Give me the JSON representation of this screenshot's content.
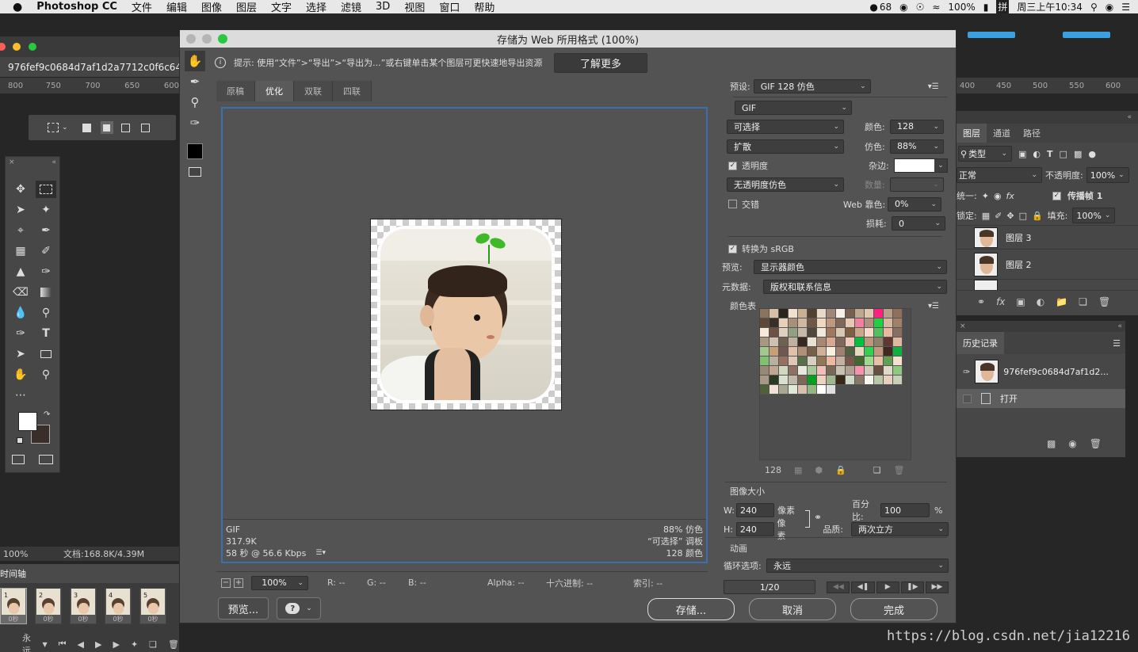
{
  "menubar": {
    "apple": "",
    "app": "Photoshop CC",
    "items": [
      "文件",
      "编辑",
      "图像",
      "图层",
      "文字",
      "选择",
      "滤镜",
      "3D",
      "视图",
      "窗口",
      "帮助"
    ],
    "qq_count": "68",
    "battery": "100%",
    "ime": "拼",
    "clock": "周三上午10:34"
  },
  "ps": {
    "doc_tab": "976fef9c0684d7af1d2a7712c0f6c64",
    "ruler": [
      "800",
      "750",
      "700",
      "650",
      "600"
    ],
    "status_zoom": "100%",
    "status_doc": "文档:168.8K/4.39M",
    "timeline_label": "时间轴",
    "frame_numbers": [
      "1",
      "2",
      "3",
      "4",
      "5"
    ],
    "frame_delay": "0秒",
    "loop": "永远"
  },
  "right_panels": {
    "ruler": [
      "400",
      "450",
      "500",
      "550",
      "600"
    ],
    "tabs": [
      "图层",
      "通道",
      "路径"
    ],
    "kind": "类型",
    "blend": "正常",
    "opacity_label": "不透明度:",
    "opacity": "100%",
    "unify": "统一:",
    "propagate": "传播帧 1",
    "lock": "锁定:",
    "fill_label": "填充:",
    "fill": "100%",
    "layers": [
      "图层 3",
      "图层 2"
    ],
    "history_title": "历史记录",
    "history_snapshot": "976fef9c0684d7af1d2...",
    "history_open": "打开"
  },
  "dialog": {
    "title": "存储为 Web 所用格式 (100%)",
    "hint": "提示: 使用“文件”>“导出”>“导出为...”或右键单击某个图层可更快速地导出资源",
    "learn_more": "了解更多",
    "tabs": [
      "原稿",
      "优化",
      "双联",
      "四联"
    ],
    "info_left": [
      "GIF",
      "317.9K",
      "58 秒 @ 56.6 Kbps"
    ],
    "info_right": [
      "88% 仿色",
      "“可选择” 调板",
      "128 颜色"
    ],
    "zoom": "100%",
    "r": "R: --",
    "g": "G: --",
    "b": "B: --",
    "alpha": "Alpha: --",
    "hex": "十六进制: --",
    "index": "索引: --",
    "preview_btn": "预览...",
    "save_btn": "存储...",
    "cancel_btn": "取消",
    "done_btn": "完成"
  },
  "settings": {
    "preset_label": "预设:",
    "preset": "GIF 128 仿色",
    "format": "GIF",
    "reduction": "可选择",
    "colors_label": "颜色:",
    "colors": "128",
    "dither_algo": "扩散",
    "dither_label": "仿色:",
    "dither": "88%",
    "transparency": "透明度",
    "matte_label": "杂边:",
    "transparency_dither": "无透明度仿色",
    "amount_label": "数量:",
    "interlaced": "交错",
    "websnap_label": "Web 靠色:",
    "websnap": "0%",
    "lossy_label": "损耗:",
    "lossy": "0",
    "srgb": "转换为 sRGB",
    "preview_label": "预览:",
    "preview_value": "显示器颜色",
    "metadata_label": "元数据:",
    "metadata": "版权和联系信息",
    "color_table": "颜色表",
    "color_count": "128",
    "image_size": "图像大小",
    "w_label": "W:",
    "w": "240",
    "h_label": "H:",
    "h": "240",
    "unit": "像素",
    "percent_label": "百分比:",
    "percent": "100",
    "pct_sign": "%",
    "quality_label": "品质:",
    "quality": "两次立方",
    "animation": "动画",
    "loop_label": "循环选项:",
    "loop": "永远",
    "frame_counter": "1/20"
  },
  "watermark": "https://blog.csdn.net/jia12216",
  "colors": {
    "accent_border": "#3d6fb0",
    "panel": "#535353",
    "dark": "#262626"
  },
  "palette": [
    "#8b7360",
    "#d8c0a8",
    "#2a231e",
    "#f0e0d0",
    "#c8b090",
    "#504030",
    "#e8d8c8",
    "#a08878",
    "#f8f0e8",
    "#786050",
    "#c0a890",
    "#e0c8b0",
    "#ff2080",
    "#b8a088",
    "#90705a",
    "#604838",
    "#3a2e28",
    "#e8d0b8",
    "#a89078",
    "#d0b8a0",
    "#705848",
    "#f0d8c0",
    "#c09880",
    "#806858",
    "#e8c8b0",
    "#f080a0",
    "#b09080",
    "#20d040",
    "#d8b8a0",
    "#a08068",
    "#f8e8d8",
    "#705040",
    "#e0d0c0",
    "#90a080",
    "#c8b8a8",
    "#504838",
    "#f0e8d8",
    "#a07860",
    "#d8c8b0",
    "#806040",
    "#c8a888",
    "#f8d8c8",
    "#50c060",
    "#e8b8a0",
    "#887060",
    "#a89880",
    "#d0c0b0",
    "#706050",
    "#c0b0a0",
    "#382820",
    "#e8e0d0",
    "#a88870",
    "#d8a890",
    "#806858",
    "#f0c8b8",
    "#00c040",
    "#b89878",
    "#90806a",
    "#603830",
    "#e0b8a0",
    "#a0c890",
    "#c8a078",
    "#705850",
    "#e0c0a8",
    "#b09078",
    "#786048",
    "#d0b098",
    "#f8f0e0",
    "#a08070",
    "#506040",
    "#e8d8c0",
    "#30d050",
    "#c09880",
    "#402820",
    "#10b040",
    "#80c070",
    "#b8b0a0",
    "#987060",
    "#e0c8b8",
    "#587048",
    "#d8d0c0",
    "#907858",
    "#f0b8a0",
    "#c8b0a0",
    "#785848",
    "#406830",
    "#a0d890",
    "#e8c0a8",
    "#60a050",
    "#f8e0d0",
    "#988878",
    "#c0a890",
    "#d0d8c0",
    "#907060",
    "#e8e8e0",
    "#a8c898",
    "#f0c0b8",
    "#786858",
    "#c8c0b0",
    "#b0a090",
    "#f890b0",
    "#d0c8b8",
    "#685040",
    "#e0d8c8",
    "#90c880",
    "#a89888",
    "#2a3a20",
    "#d8e0d0",
    "#c0b8a8",
    "#806858",
    "#00a020",
    "#f0d0c0",
    "#a0b890",
    "#382818",
    "#d0d8c8",
    "#887868",
    "#f8f8f0",
    "#b8c8a8",
    "#e8d0c0",
    "#c8d0b8",
    "#506038",
    "#f0e0d8",
    "#a8a890",
    "#e0e8d8",
    "#d8c0b0",
    "#90b880",
    "#ffffff",
    "#e0e0e0"
  ]
}
